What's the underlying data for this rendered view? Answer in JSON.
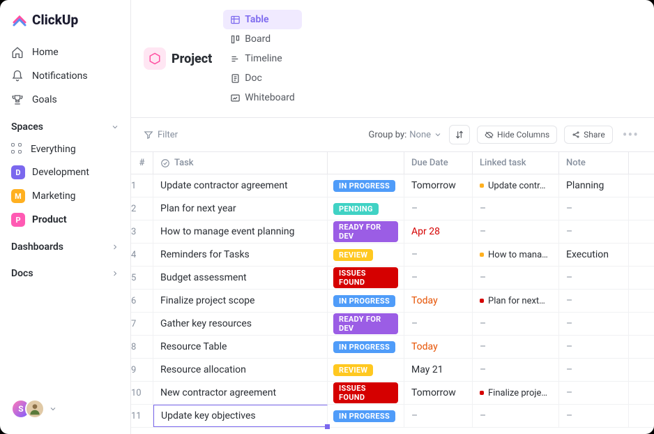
{
  "brand": {
    "name": "ClickUp"
  },
  "sidebar": {
    "nav": [
      {
        "label": "Home",
        "icon": "home-icon"
      },
      {
        "label": "Notifications",
        "icon": "bell-icon"
      },
      {
        "label": "Goals",
        "icon": "trophy-icon"
      }
    ],
    "spaces_header": "Spaces",
    "everything_label": "Everything",
    "spaces": [
      {
        "label": "Development",
        "badge": "D",
        "color": "#7b68ee"
      },
      {
        "label": "Marketing",
        "badge": "M",
        "color": "#ffb020"
      },
      {
        "label": "Product",
        "badge": "P",
        "color": "#ff5ab3",
        "active": true
      }
    ],
    "dashboards_label": "Dashboards",
    "docs_label": "Docs",
    "user_initial": "S"
  },
  "header": {
    "title": "Project",
    "views": [
      {
        "label": "Table",
        "active": true
      },
      {
        "label": "Board"
      },
      {
        "label": "Timeline"
      },
      {
        "label": "Doc"
      },
      {
        "label": "Whiteboard"
      }
    ]
  },
  "toolbar": {
    "filter_label": "Filter",
    "group_by_label": "Group by:",
    "group_by_value": "None",
    "hide_columns": "Hide Columns",
    "share": "Share"
  },
  "columns": {
    "num": "#",
    "task": "Task",
    "due": "Due Date",
    "linked": "Linked task",
    "note": "Note"
  },
  "status_colors": {
    "IN PROGRESS": "#4f9cf9",
    "PENDING": "#40d2c4",
    "READY FOR DEV": "#9b5de5",
    "REVIEW": "#ffc820",
    "ISSUES FOUND": "#d50000"
  },
  "rows": [
    {
      "n": "1",
      "task": "Update contractor agreement",
      "status": "IN PROGRESS",
      "due": "Tomorrow",
      "linked": "Update contr…",
      "linked_color": "#ffb020",
      "note": "Planning"
    },
    {
      "n": "2",
      "task": "Plan for next year",
      "status": "PENDING",
      "due": "–",
      "linked": "–",
      "note": "–"
    },
    {
      "n": "3",
      "task": "How to manage event planning",
      "status": "READY FOR DEV",
      "due": "Apr 28",
      "due_class": "due-red",
      "linked": "–",
      "note": "–"
    },
    {
      "n": "4",
      "task": "Reminders for Tasks",
      "status": "REVIEW",
      "due": "–",
      "linked": "How to mana…",
      "linked_color": "#ffb020",
      "note": "Execution"
    },
    {
      "n": "5",
      "task": "Budget assessment",
      "status": "ISSUES FOUND",
      "due": "–",
      "linked": "–",
      "note": "–"
    },
    {
      "n": "6",
      "task": "Finalize project scope",
      "status": "IN PROGRESS",
      "due": "Today",
      "due_class": "due-today",
      "linked": "Plan for next…",
      "linked_color": "#d50000",
      "note": "–"
    },
    {
      "n": "7",
      "task": "Gather key resources",
      "status": "READY FOR DEV",
      "due": "–",
      "linked": "–",
      "note": "–"
    },
    {
      "n": "8",
      "task": "Resource Table",
      "status": "IN PROGRESS",
      "due": "Today",
      "due_class": "due-today",
      "linked": "–",
      "note": "–"
    },
    {
      "n": "9",
      "task": "Resource allocation",
      "status": "REVIEW",
      "due": "May 21",
      "linked": "–",
      "note": "–"
    },
    {
      "n": "10",
      "task": "New contractor agreement",
      "status": "ISSUES FOUND",
      "due": "Tomorrow",
      "linked": "Finalize proje…",
      "linked_color": "#d50000",
      "note": "–"
    },
    {
      "n": "11",
      "task": "Update key objectives",
      "status": "IN PROGRESS",
      "due": "–",
      "linked": "–",
      "note": "–",
      "editing": true
    }
  ]
}
